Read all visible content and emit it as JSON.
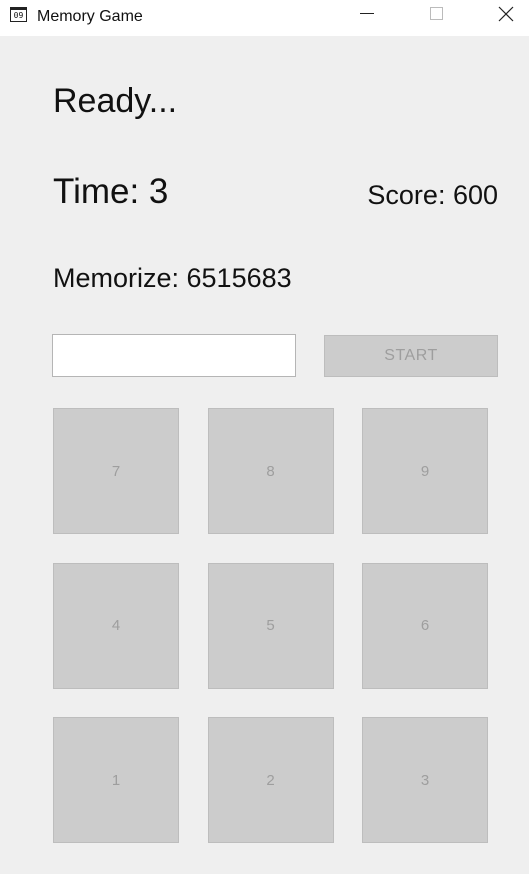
{
  "window": {
    "title": "Memory Game",
    "icon_text": "09",
    "controls": {
      "minimize": "minimize-icon",
      "maximize": "maximize-icon",
      "close": "close-icon"
    }
  },
  "game": {
    "status": "Ready...",
    "time": "Time: 3",
    "score": "Score: 600",
    "memorize": "Memorize: 6515683"
  },
  "input": {
    "value": "",
    "placeholder": ""
  },
  "start_button": {
    "label": "START"
  },
  "keypad": {
    "keys": [
      "7",
      "8",
      "9",
      "4",
      "5",
      "6",
      "1",
      "2",
      "3"
    ]
  },
  "colors": {
    "background": "#efefef",
    "titlebar": "#ffffff",
    "button_fill": "#cccccc",
    "button_text": "#9e9e9e"
  }
}
